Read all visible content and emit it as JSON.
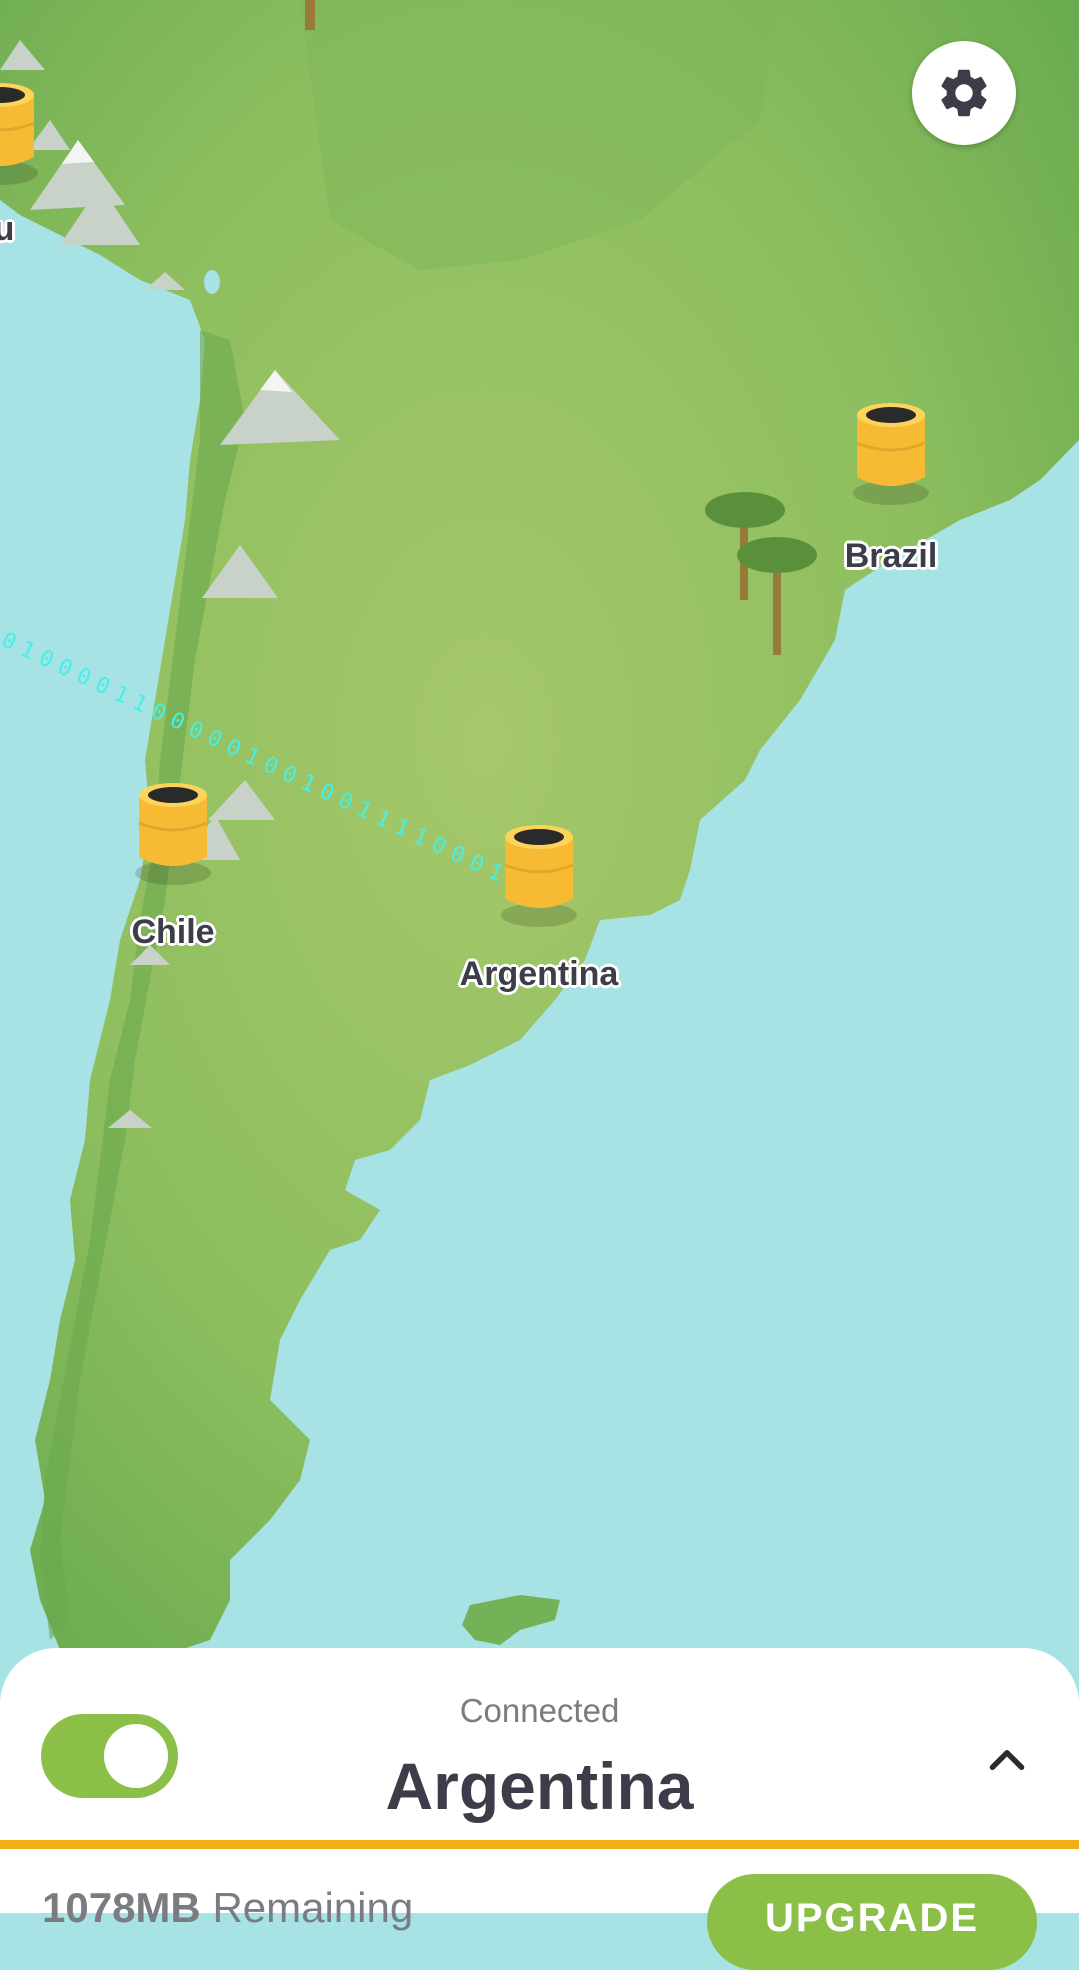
{
  "map": {
    "servers": [
      {
        "id": "chile",
        "label": "Chile"
      },
      {
        "id": "argentina",
        "label": "Argentina"
      },
      {
        "id": "brazil",
        "label": "Brazil"
      },
      {
        "id": "peru",
        "label": "u"
      }
    ],
    "tunnel_binary": "0100001100000100100111100011",
    "colors": {
      "ocean": "#a7e2e5",
      "land": "#8bbd5d",
      "tunnel": "#46f0e8",
      "pin": "#f7bb33"
    }
  },
  "settings": {
    "icon": "gear-icon"
  },
  "connection": {
    "status": "Connected",
    "country": "Argentina",
    "expand_icon": "chevron-up-icon",
    "enabled": true
  },
  "footer": {
    "data_amount": "1078MB",
    "data_label": "Remaining",
    "upgrade_label": "UPGRADE"
  },
  "colors": {
    "accent_green": "#8bbf48",
    "accent_yellow": "#f2ae16",
    "text_dark": "#3d3d4a"
  }
}
